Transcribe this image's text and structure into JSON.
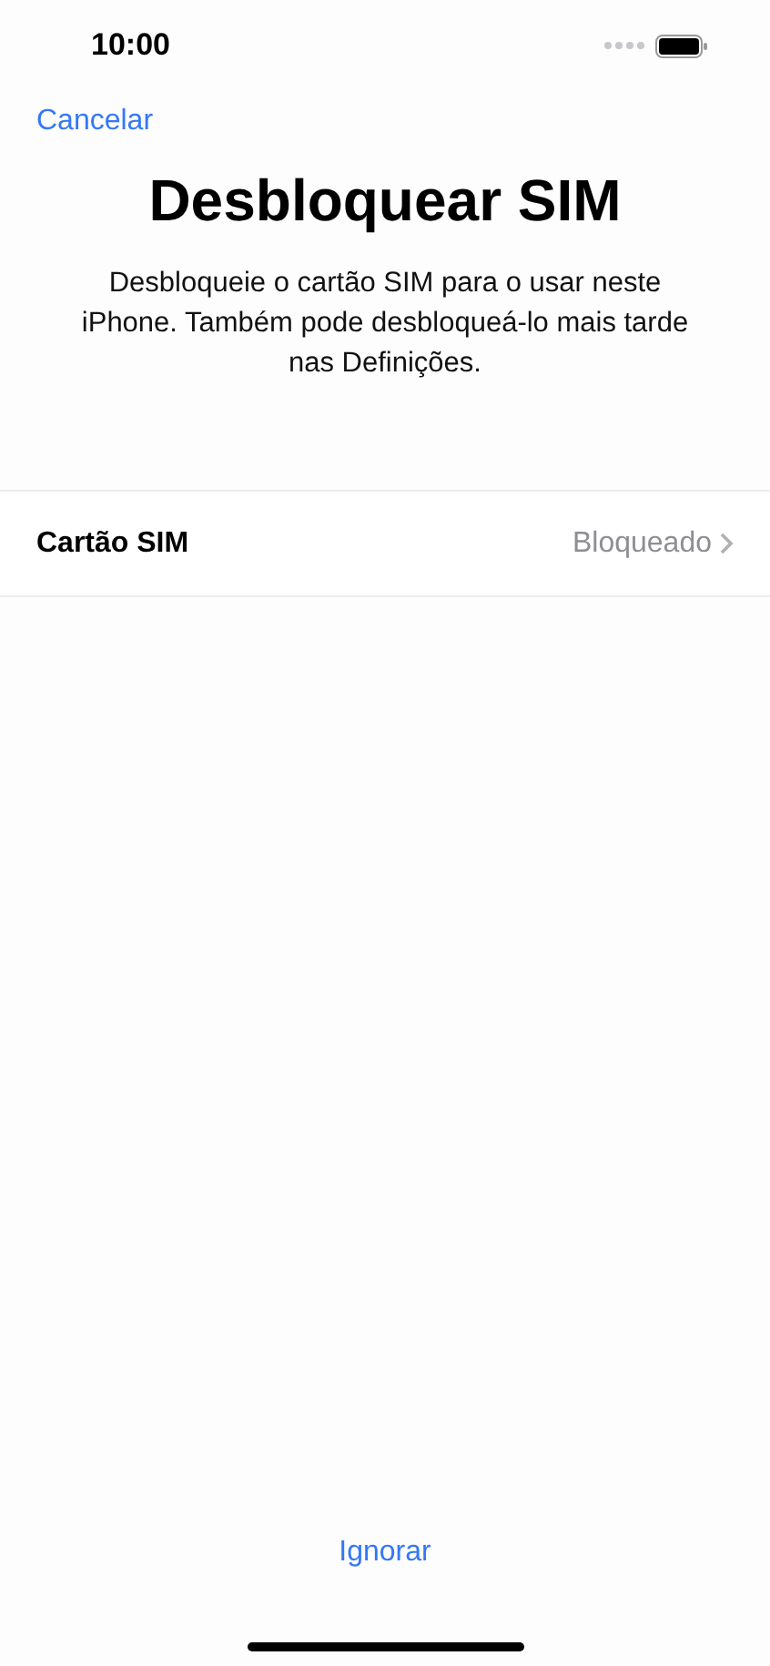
{
  "status_bar": {
    "time": "10:00"
  },
  "nav": {
    "cancel": "Cancelar"
  },
  "title": "Desbloquear SIM",
  "description": "Desbloqueie o cartão SIM para o usar neste iPhone. Também pode desbloqueá-lo mais tarde nas Definições.",
  "rows": [
    {
      "label": "Cartão SIM",
      "value": "Bloqueado"
    }
  ],
  "footer": {
    "skip": "Ignorar"
  }
}
